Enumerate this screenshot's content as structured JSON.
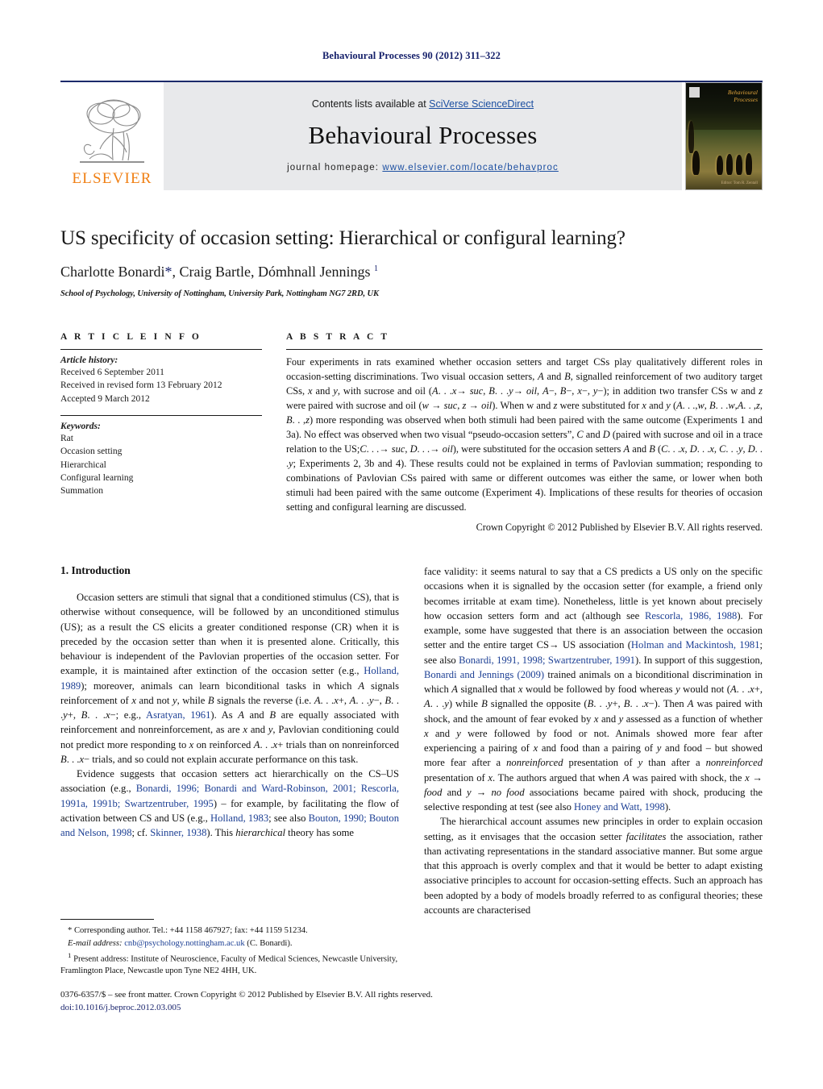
{
  "running_head": "Behavioural Processes 90 (2012) 311–322",
  "masthead": {
    "contents_prefix": "Contents lists available at ",
    "sciencedirect": "SciVerse ScienceDirect",
    "journal_title": "Behavioural Processes",
    "homepage_label": "journal homepage: ",
    "homepage_url": "www.elsevier.com/locate/behavproc",
    "publisher_wordmark": "ELSEVIER",
    "cover_title_line1": "Behavioural",
    "cover_title_line2": "Processes",
    "cover_caption": "Editor: Tom R. Zentall"
  },
  "title": "US specificity of occasion setting: Hierarchical or configural learning?",
  "authors_html": "Charlotte Bonardi<span class=\"star\">*</span>, Craig Bartle, Dómhnall Jennings <sup>1</sup>",
  "affiliation": "School of Psychology, University of Nottingham, University Park, Nottingham NG7 2RD, UK",
  "article_info": {
    "kicker": "A R T I C L E   I N F O",
    "history_label": "Article history:",
    "history": [
      "Received 6 September 2011",
      "Received in revised form 13 February 2012",
      "Accepted 9 March 2012"
    ],
    "keywords_label": "Keywords:",
    "keywords": [
      "Rat",
      "Occasion setting",
      "Hierarchical",
      "Configural learning",
      "Summation"
    ]
  },
  "abstract": {
    "kicker": "A B S T R A C T",
    "text_html": "Four experiments in rats examined whether occasion setters and target CSs play qualitatively different roles in occasion-setting discriminations. Two visual occasion setters, <i>A</i> and <i>B</i>, signalled reinforcement of two auditory target CSs, <i>x</i> and <i>y</i>, with sucrose and oil (<i>A</i>. . .<i>x</i>&#8594; <i>suc</i>, <i>B</i>. . .<i>y</i>&#8594; <i>oil</i>, <i>A</i>−, <i>B</i>−, <i>x</i>−, <i>y</i>−); in addition two transfer CSs w and <i>z</i> were paired with sucrose and oil (<i>w</i> &#8594; <i>suc</i>, <i>z</i> &#8594; <i>oil</i>). When w and <i>z</i> were substituted for <i>x</i> and <i>y</i> (<i>A</i>. . .,<i>w</i>, <i>B</i>. . .<i>w</i>,<i>A</i>. . ,<i>z</i>, <i>B</i>. . ,<i>z</i>) more responding was observed when both stimuli had been paired with the same outcome (Experiments 1 and 3a). No effect was observed when two visual “pseudo-occasion setters”, <i>C</i> and <i>D</i> (paired with sucrose and oil in a trace relation to the US;<i>C</i>. . .&#8594; <i>suc</i>, <i>D</i>. . .&#8594; <i>oil</i>), were substituted for the occasion setters <i>A</i> and <i>B</i> (<i>C</i>. . .<i>x</i>, <i>D</i>. . .<i>x</i>, <i>C</i>. . .<i>y</i>, <i>D</i>. . .<i>y</i>; Experiments 2, 3b and 4). These results could not be explained in terms of Pavlovian summation; responding to combinations of Pavlovian CSs paired with same or different outcomes was either the same, or lower when both stimuli had been paired with the same outcome (Experiment 4). Implications of these results for theories of occasion setting and configural learning are discussed.",
    "copyright": "Crown Copyright © 2012 Published by Elsevier B.V. All rights reserved."
  },
  "body": {
    "intro_heading": "1.  Introduction",
    "left_paragraphs_html": [
      "Occasion setters are stimuli that signal that a conditioned stimulus (CS), that is otherwise without consequence, will be followed by an unconditioned stimulus (US); as a result the CS elicits a greater conditioned response (CR) when it is preceded by the occasion setter than when it is presented alone. Critically, this behaviour is independent of the Pavlovian properties of the occasion setter. For example, it is maintained after extinction of the occasion setter (e.g., <span class=\"cite\">Holland, 1989</span>); moreover, animals can learn biconditional tasks in which <i>A</i> signals reinforcement of <i>x</i> and not <i>y</i>, while <i>B</i> signals the reverse (i.e. <i>A</i>. . .<i>x</i>+, <i>A</i>. . .<i>y</i>−, <i>B</i>. . .<i>y</i>+, <i>B</i>. . .<i>x</i>−; e.g., <span class=\"cite\">Asratyan, 1961</span>). As <i>A</i> and <i>B</i> are equally associated with reinforcement and nonreinforcement, as are <i>x</i> and <i>y</i>, Pavlovian conditioning could not predict more responding to <i>x</i> on reinforced <i>A</i>. . .<i>x</i>+ trials than on nonreinforced <i>B</i>. . .<i>x</i>− trials, and so could not explain accurate performance on this task.",
      "Evidence suggests that occasion setters act hierarchically on the CS–US association (e.g., <span class=\"cite\">Bonardi, 1996; Bonardi and Ward-Robinson, 2001; Rescorla, 1991a, 1991b; Swartzentruber, 1995</span>) – for example, by facilitating the flow of activation between CS and US (e.g., <span class=\"cite\">Holland, 1983</span>; see also <span class=\"cite\">Bouton, 1990; Bouton and Nelson, 1998</span>; cf. <span class=\"cite\">Skinner, 1938</span>). This <i>hierarchical</i> theory has some"
    ],
    "right_paragraphs_html": [
      "face validity: it seems natural to say that a CS predicts a US only on the specific occasions when it is signalled by the occasion setter (for example, a friend only becomes irritable at exam time). Nonetheless, little is yet known about precisely how occasion setters form and act (although see <span class=\"cite\">Rescorla, 1986, 1988</span>). For example, some have suggested that there is an association between the occasion setter and the entire target CS&#8594; US association (<span class=\"cite\">Holman and Mackintosh, 1981</span>; see also <span class=\"cite\">Bonardi, 1991, 1998; Swartzentruber, 1991</span>). In support of this suggestion, <span class=\"cite\">Bonardi and Jennings (2009)</span> trained animals on a biconditional discrimination in which <i>A</i> signalled that <i>x</i> would be followed by food whereas <i>y</i> would not (<i>A</i>. . .<i>x</i>+, <i>A</i>. . .<i>y</i>) while <i>B</i> signalled the opposite (<i>B</i>. . .<i>y</i>+, <i>B</i>. . .<i>x</i>−). Then <i>A</i> was paired with shock, and the amount of fear evoked by <i>x</i> and <i>y</i> assessed as a function of whether <i>x</i> and <i>y</i> were followed by food or not. Animals showed more fear after experiencing a pairing of <i>x</i> and food than a pairing of <i>y</i> and food – but showed more fear after a <i>nonreinforced</i> presentation of <i>y</i> than after a <i>nonreinforced</i> presentation of <i>x</i>. The authors argued that when <i>A</i> was paired with shock, the <i>x</i> &#8594; <i>food</i> and <i>y</i> &#8594; <i>no food</i> associations became paired with shock, producing the selective responding at test (see also <span class=\"cite\">Honey and Watt, 1998</span>).",
      "The hierarchical account assumes new principles in order to explain occasion setting, as it envisages that the occasion setter <i>facilitates</i> the association, rather than activating representations in the standard associative manner. But some argue that this approach is overly complex and that it would be better to adapt existing associative principles to account for occasion-setting effects. Such an approach has been adopted by a body of models broadly referred to as configural theories; these accounts are characterised"
    ]
  },
  "footnotes": {
    "corresponding_html": "* Corresponding author. Tel.: +44 1158 467927; fax: +44 1159 51234.",
    "email_html": "<i>E-mail address:</i> <span class=\"mail\">cnb@psychology.nottingham.ac.uk</span> (C. Bonardi).",
    "present_address_html": "<sup>1</sup> Present address: Institute of Neuroscience, Faculty of Medical Sciences, Newcastle University, Framlington Place, Newcastle upon Tyne NE2 4HH, UK."
  },
  "colophon": {
    "issn_line": "0376-6357/$ – see front matter. Crown Copyright © 2012 Published by Elsevier B.V. All rights reserved.",
    "doi_line": "doi:10.1016/j.beproc.2012.03.005"
  }
}
